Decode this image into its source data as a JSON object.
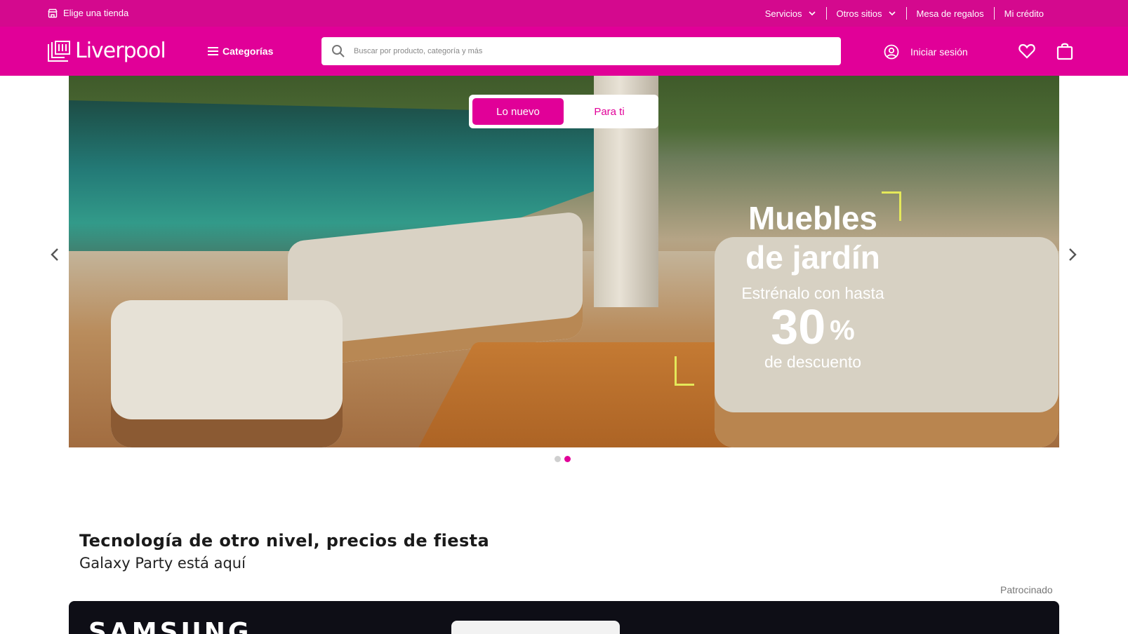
{
  "topbar": {
    "store_label": "Elige una tienda",
    "links": [
      {
        "label": "Servicios",
        "has_chevron": true
      },
      {
        "label": "Otros sitios",
        "has_chevron": true
      },
      {
        "label": "Mesa de regalos",
        "has_chevron": false
      },
      {
        "label": "Mi crédito",
        "has_chevron": false
      }
    ]
  },
  "header": {
    "logo_text": "Liverpool",
    "categories_label": "Categorías",
    "search_placeholder": "Buscar por producto, categoría y más",
    "login_label": "Iniciar sesión",
    "icons": [
      "store-icon",
      "menu-icon",
      "search-icon",
      "user-icon",
      "heart-icon",
      "bag-icon"
    ]
  },
  "hero": {
    "tabs": [
      {
        "label": "Lo nuevo",
        "active": true
      },
      {
        "label": "Para ti",
        "active": false
      }
    ],
    "headline_line1": "Muebles",
    "headline_line2": "de jardín",
    "subline": "Estrénalo con hasta",
    "discount": "30",
    "percent_sign": "%",
    "discount_label": "de descuento",
    "slide_count": 2,
    "active_slide": 2
  },
  "section": {
    "title": "Tecnología de otro nivel, precios de fiesta",
    "subtitle": "Galaxy Party está aquí",
    "sponsored_label": "Patrocinado",
    "banner_brand": "SAMSUNG"
  },
  "colors": {
    "brand": "#e10098",
    "topbar": "#d4098e",
    "accent_corner": "#e4e85a"
  }
}
